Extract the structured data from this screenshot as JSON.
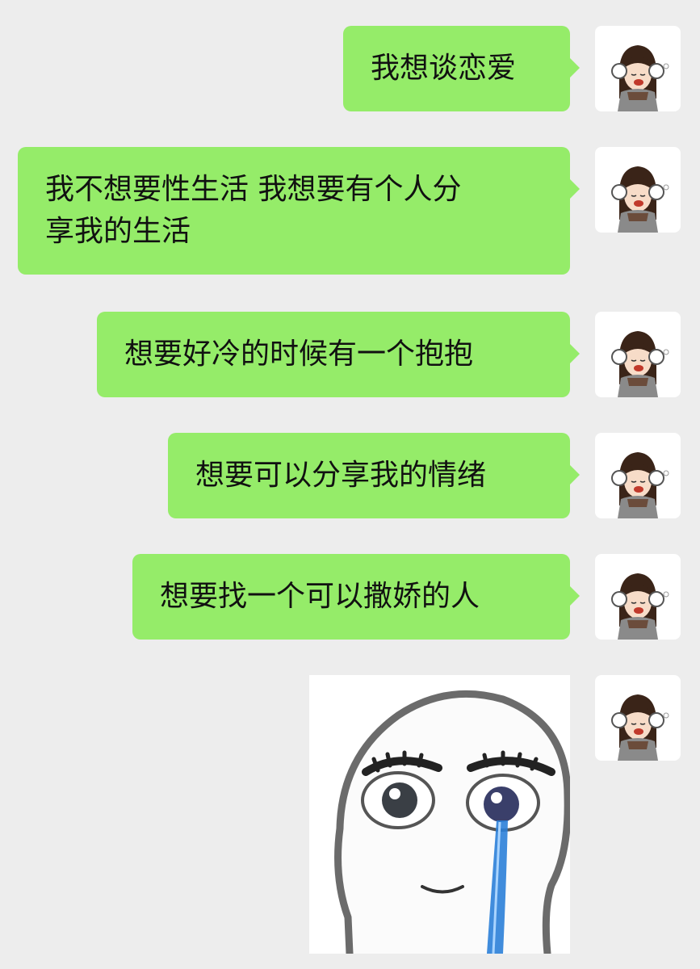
{
  "chat": {
    "messages": [
      {
        "text": "我想谈恋爱"
      },
      {
        "text": "我不想要性生活 我想要有个人分\n享我的生活"
      },
      {
        "text": "想要好冷的时候有一个抱抱"
      },
      {
        "text": "想要可以分享我的情绪"
      },
      {
        "text": "想要找一个可以撒娇的人"
      }
    ],
    "sticker": {
      "icon": "crying-face-sticker"
    },
    "avatar": {
      "icon": "girl-earmuffs-avatar-icon"
    }
  },
  "colors": {
    "background": "#ededed",
    "bubble": "#95ec69",
    "text": "#111111"
  }
}
